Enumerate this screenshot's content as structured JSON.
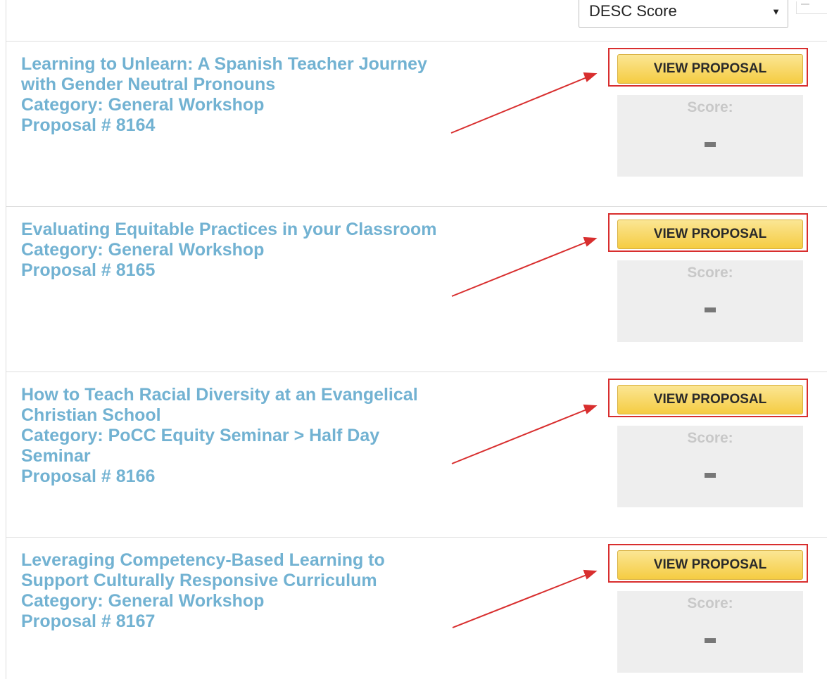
{
  "sort": {
    "selected": "DESC Score",
    "caret": "▼"
  },
  "proposals": [
    {
      "title_lines": [
        "Learning to Unlearn: A Spanish Teacher Journey",
        "with Gender Neutral Pronouns"
      ],
      "category": "Category: General Workshop",
      "proposal_number": "Proposal # 8164",
      "button_label": "VIEW PROPOSAL",
      "score_label": "Score:",
      "score_value": "—"
    },
    {
      "title_lines": [
        "Evaluating Equitable Practices in your Classroom"
      ],
      "category": "Category: General Workshop",
      "proposal_number": "Proposal # 8165",
      "button_label": "VIEW PROPOSAL",
      "score_label": "Score:",
      "score_value": "—"
    },
    {
      "title_lines": [
        "How to Teach Racial Diversity at an Evangelical",
        "Christian School"
      ],
      "category_lines": [
        "Category: PoCC Equity Seminar > Half Day",
        "Seminar"
      ],
      "proposal_number": "Proposal # 8166",
      "button_label": "VIEW PROPOSAL",
      "score_label": "Score:",
      "score_value": "—"
    },
    {
      "title_lines": [
        "Leveraging Competency-Based Learning to",
        "Support Culturally Responsive Curriculum"
      ],
      "category": "Category: General Workshop",
      "proposal_number": "Proposal # 8167",
      "button_label": "VIEW PROPOSAL",
      "score_label": "Score:",
      "score_value": "—"
    }
  ],
  "colors": {
    "title_text": "#72b2d2",
    "button_fill": "#f5cc42",
    "highlight_box": "#d82e2e",
    "arrow": "#d82e2e",
    "score_box": "#eeeeee"
  }
}
